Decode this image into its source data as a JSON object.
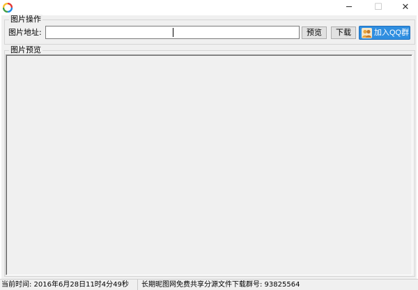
{
  "window": {
    "icon": "app-logo-icon",
    "controls": {
      "minimize": "─",
      "maximize": "☐",
      "close": "✕"
    }
  },
  "ops_group": {
    "title": "图片操作",
    "url_label": "图片地址:",
    "url_value": "",
    "preview_button": "预览",
    "download_button": "下载",
    "qq_button": "加入QQ群",
    "qq_icon": "qq-group-icon"
  },
  "preview_group": {
    "title": "图片预览"
  },
  "status": {
    "time": "当前时间: 2016年6月28日11时4分49秒",
    "info": "长期昵图网免费共享分源文件下载群号: 93825564"
  },
  "colors": {
    "qq_button": "#2f8ee0",
    "client_bg": "#f0f0f0"
  }
}
